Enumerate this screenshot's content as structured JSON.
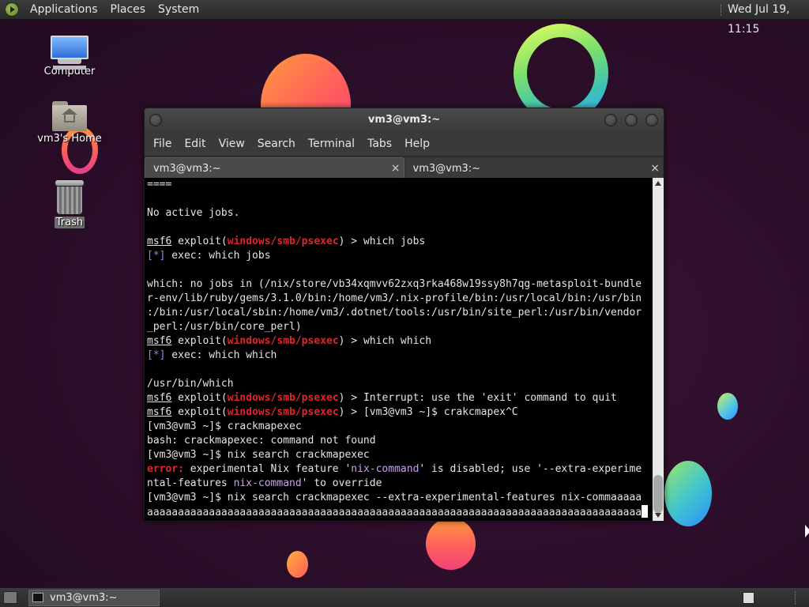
{
  "top_panel": {
    "menus": [
      "Applications",
      "Places",
      "System"
    ],
    "clock": "Wed Jul 19, 11:15"
  },
  "desktop": {
    "icons": [
      {
        "label": "Computer",
        "icon": "computer-icon"
      },
      {
        "label": "vm3's Home",
        "icon": "home-folder-icon"
      },
      {
        "label": "Trash",
        "icon": "trash-icon"
      }
    ]
  },
  "terminal": {
    "title": "vm3@vm3:~",
    "menu": [
      "File",
      "Edit",
      "View",
      "Search",
      "Terminal",
      "Tabs",
      "Help"
    ],
    "tabs": [
      {
        "label": "vm3@vm3:~",
        "active": true,
        "close": "×"
      },
      {
        "label": "vm3@vm3:~",
        "active": false,
        "close": "×"
      }
    ],
    "lines": [
      "====",
      "",
      "No active jobs.",
      "",
      "msf6 exploit(windows/smb/psexec) > which jobs",
      "[*] exec: which jobs",
      "",
      "which: no jobs in (/nix/store/vb34xqmvv62zxq3rka468w19ssy8h7qg-metasploit-bundle",
      "r-env/lib/ruby/gems/3.1.0/bin:/home/vm3/.nix-profile/bin:/usr/local/bin:/usr/bin",
      ":/bin:/usr/local/sbin:/home/vm3/.dotnet/tools:/usr/bin/site_perl:/usr/bin/vendor",
      "_perl:/usr/bin/core_perl)",
      "msf6 exploit(windows/smb/psexec) > which which",
      "[*] exec: which which",
      "",
      "/usr/bin/which",
      "msf6 exploit(windows/smb/psexec) > Interrupt: use the 'exit' command to quit",
      "msf6 exploit(windows/smb/psexec) > [vm3@vm3 ~]$ crakcmapex^C",
      "[vm3@vm3 ~]$ crackmapexec",
      "bash: crackmapexec: command not found",
      "[vm3@vm3 ~]$ nix search crackmapexec",
      "error: experimental Nix feature 'nix-command' is disabled; use '--extra-experime",
      "ntal-features nix-command' to override",
      "[vm3@vm3 ~]$ nix search crackmapexec --extra-experimental-features nix-commaaaaa",
      "aaaaaaaaaaaaaaaaaaaaaaaaaaaaaaaaaaaaaaaaaaaaaaaaaaaaaaaaaaaaaaaaaaaaaaaaaaaaaaaa"
    ],
    "colors": {
      "red": "#e0242a",
      "blue": "#7f8de8",
      "purple": "#c8a2e6",
      "background": "#000000",
      "foreground": "#e4e4e4"
    }
  },
  "bottom_panel": {
    "task_label": "vm3@vm3:~"
  }
}
